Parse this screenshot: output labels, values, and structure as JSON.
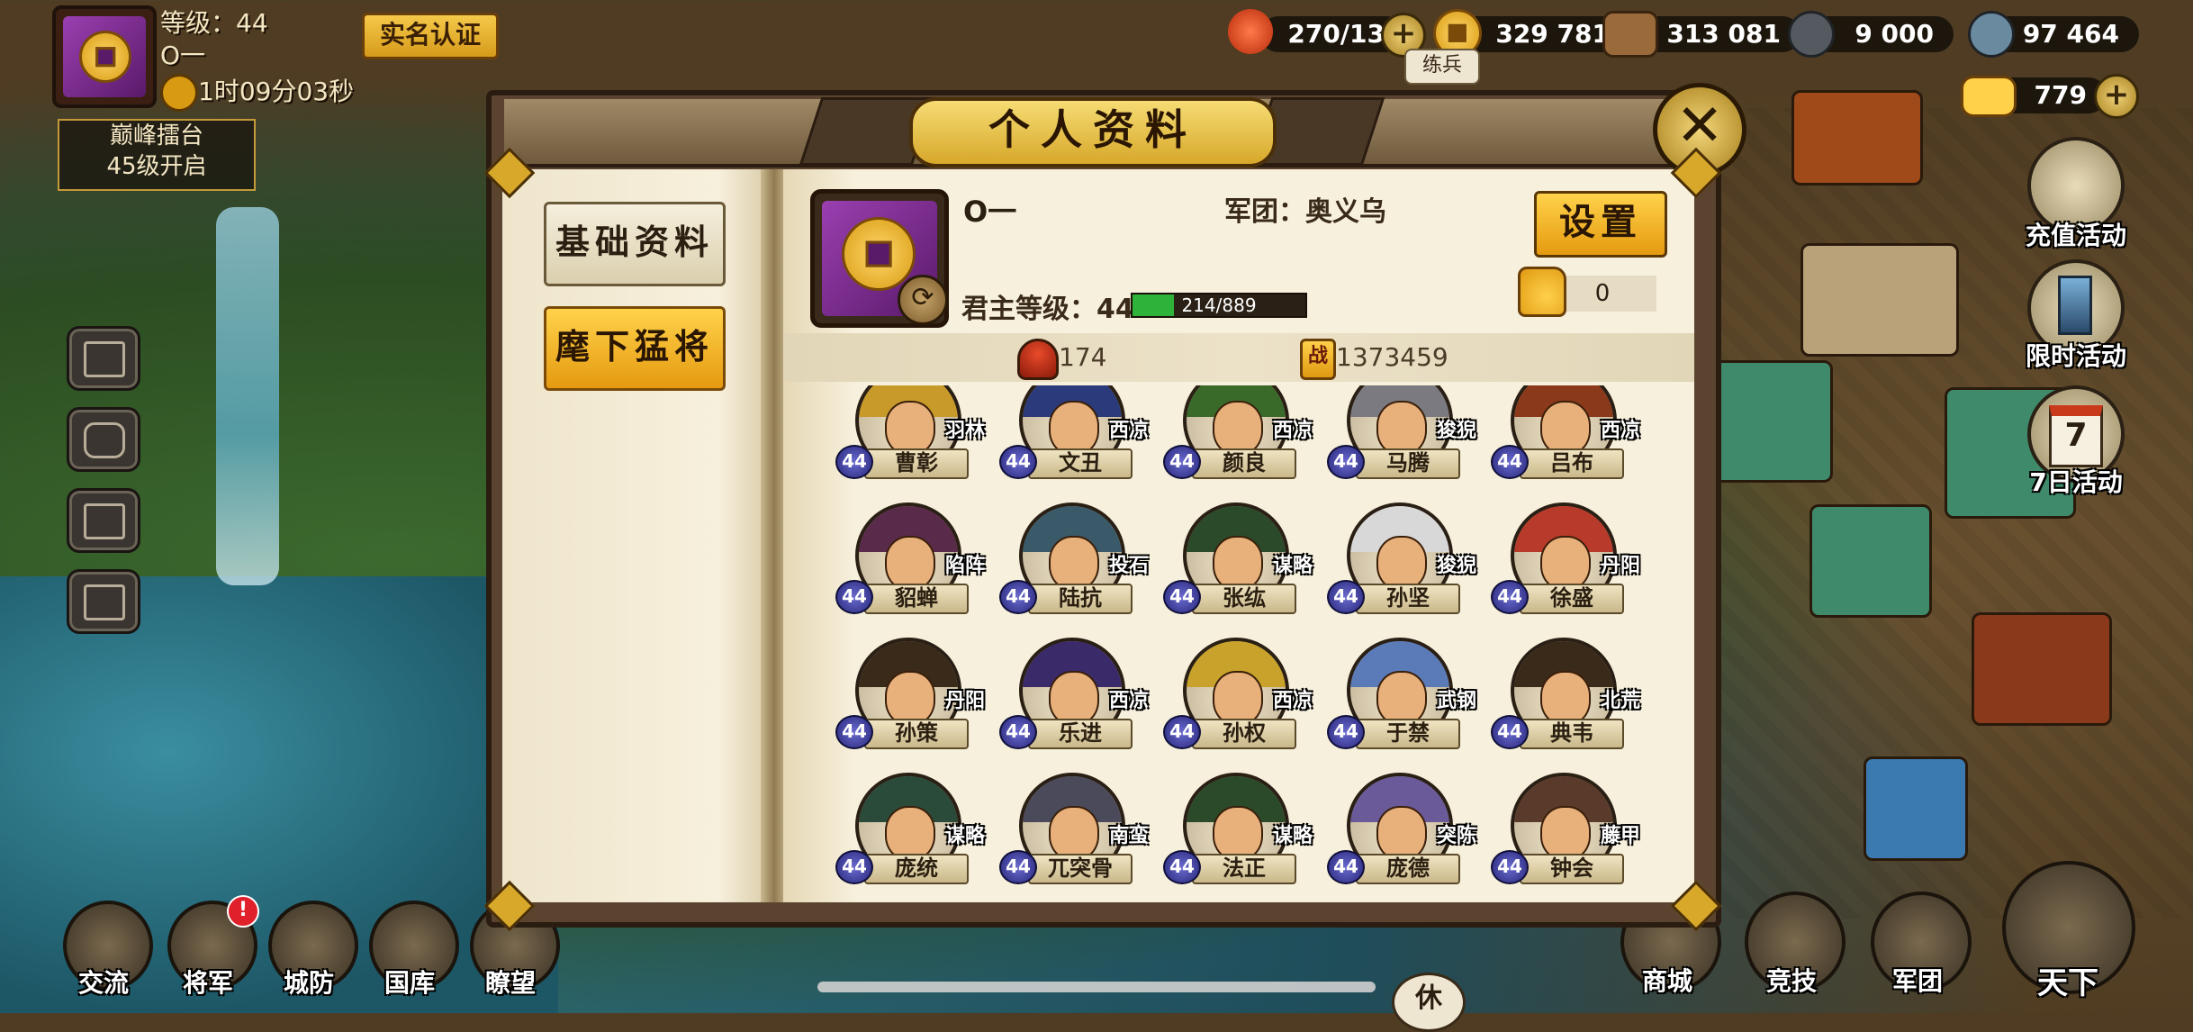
{
  "player": {
    "level_label": "等级：44",
    "name": "O一",
    "timer": "1时09分03秒",
    "realname_button": "实名认证",
    "arena_line1": "巅峰擂台",
    "arena_line2": "45级开启"
  },
  "resources": {
    "stamina": "270/13",
    "gold": "329 781",
    "wood": "313 081",
    "iron": "9 000",
    "stone": "97 464",
    "ingot": "779"
  },
  "map_label": "练兵",
  "bottom_nav": [
    "交流",
    "将军",
    "城防",
    "国库",
    "瞭望"
  ],
  "bottom_right_nav": [
    "商城",
    "竞技",
    "军团",
    "天下"
  ],
  "bottom_misc": "休",
  "right_events": [
    "充值活动",
    "限时活动",
    "7日活动"
  ],
  "right_event_calendar_num": "7",
  "modal": {
    "title": "个人资料",
    "close": "✕",
    "tabs": [
      "基础资料",
      "麾下猛将"
    ],
    "active_tab": 1,
    "profile": {
      "name": "O一",
      "legion": "军团：奥义乌",
      "lord_level": "君主等级：44",
      "xp_text": "214/889",
      "xp_fraction": 0.24,
      "settings": "设置",
      "likes": "0",
      "heroes_count": "174",
      "power": "1373459",
      "power_icon": "战"
    },
    "heroes": [
      {
        "name": "曹彰",
        "tag": "羽林",
        "level": "44",
        "hair": "#c89a2a"
      },
      {
        "name": "文丑",
        "tag": "西凉",
        "level": "44",
        "hair": "#2a3a7a"
      },
      {
        "name": "颜良",
        "tag": "西凉",
        "level": "44",
        "hair": "#3a6a2a"
      },
      {
        "name": "马腾",
        "tag": "狻猊",
        "level": "44",
        "hair": "#7a7a80"
      },
      {
        "name": "吕布",
        "tag": "西凉",
        "level": "44",
        "hair": "#8a3a1a"
      },
      {
        "name": "貂蝉",
        "tag": "陷阵",
        "level": "44",
        "hair": "#5a2a4a"
      },
      {
        "name": "陆抗",
        "tag": "投石",
        "level": "44",
        "hair": "#3a5a6a"
      },
      {
        "name": "张纮",
        "tag": "谋略",
        "level": "44",
        "hair": "#2a4a2a"
      },
      {
        "name": "孙坚",
        "tag": "狻猊",
        "level": "44",
        "hair": "#d8d8d8"
      },
      {
        "name": "徐盛",
        "tag": "丹阳",
        "level": "44",
        "hair": "#b83a2a"
      },
      {
        "name": "孙策",
        "tag": "丹阳",
        "level": "44",
        "hair": "#3a2a1a"
      },
      {
        "name": "乐进",
        "tag": "西凉",
        "level": "44",
        "hair": "#3a2a6a"
      },
      {
        "name": "孙权",
        "tag": "西凉",
        "level": "44",
        "hair": "#c8a22a"
      },
      {
        "name": "于禁",
        "tag": "武钢",
        "level": "44",
        "hair": "#5a7ab8"
      },
      {
        "name": "典韦",
        "tag": "北荒",
        "level": "44",
        "hair": "#3a2a1a"
      },
      {
        "name": "庞统",
        "tag": "谋略",
        "level": "44",
        "hair": "#2a4a3a"
      },
      {
        "name": "兀突骨",
        "tag": "南蛮",
        "level": "44",
        "hair": "#4a4a5a"
      },
      {
        "name": "法正",
        "tag": "谋略",
        "level": "44",
        "hair": "#2a4a2a"
      },
      {
        "name": "庞德",
        "tag": "突陈",
        "level": "44",
        "hair": "#6a5a9a"
      },
      {
        "name": "钟会",
        "tag": "藤甲",
        "level": "44",
        "hair": "#5a3a2a"
      }
    ]
  },
  "colors": {
    "accent_gold": "#e59a10",
    "parchment": "#f7f0dc",
    "xp_green": "#2fb23a",
    "frame_brown": "#5a4430"
  }
}
